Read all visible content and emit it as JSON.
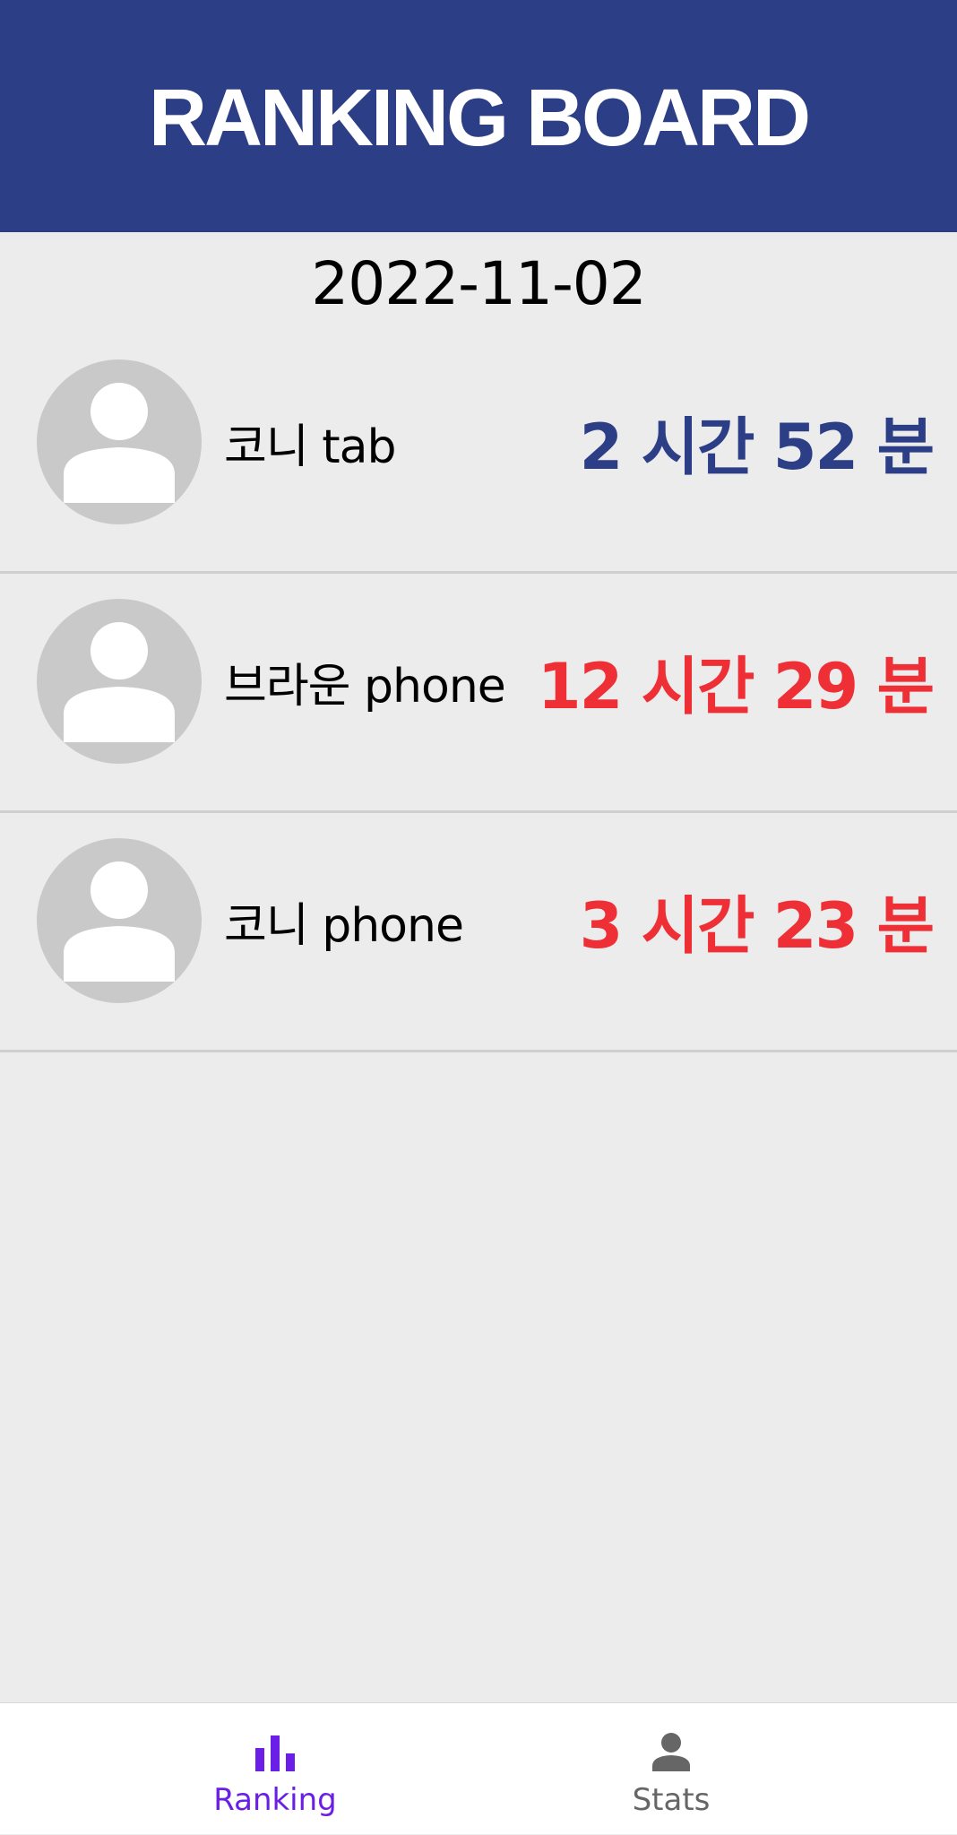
{
  "header": {
    "title": "RANKING BOARD",
    "background_color": "#2c3f86"
  },
  "date": "2022-11-02",
  "ranking": [
    {
      "name": "코니 tab",
      "time": "2 시간 52 분",
      "time_color": "#2c3f86",
      "avatar_icon": "person-avatar-icon"
    },
    {
      "name": "브라운 phone",
      "time": "12 시간 29 분",
      "time_color": "#ee2f36",
      "avatar_icon": "person-avatar-icon"
    },
    {
      "name": "코니 phone",
      "time": "3 시간 23 분",
      "time_color": "#ee2f36",
      "avatar_icon": "person-avatar-icon"
    }
  ],
  "bottom_nav": {
    "items": [
      {
        "label": "Ranking",
        "icon": "bar-chart-icon",
        "active": true,
        "color": "#6a1ee6"
      },
      {
        "label": "Stats",
        "icon": "person-icon",
        "active": false,
        "color": "#666666"
      }
    ]
  }
}
